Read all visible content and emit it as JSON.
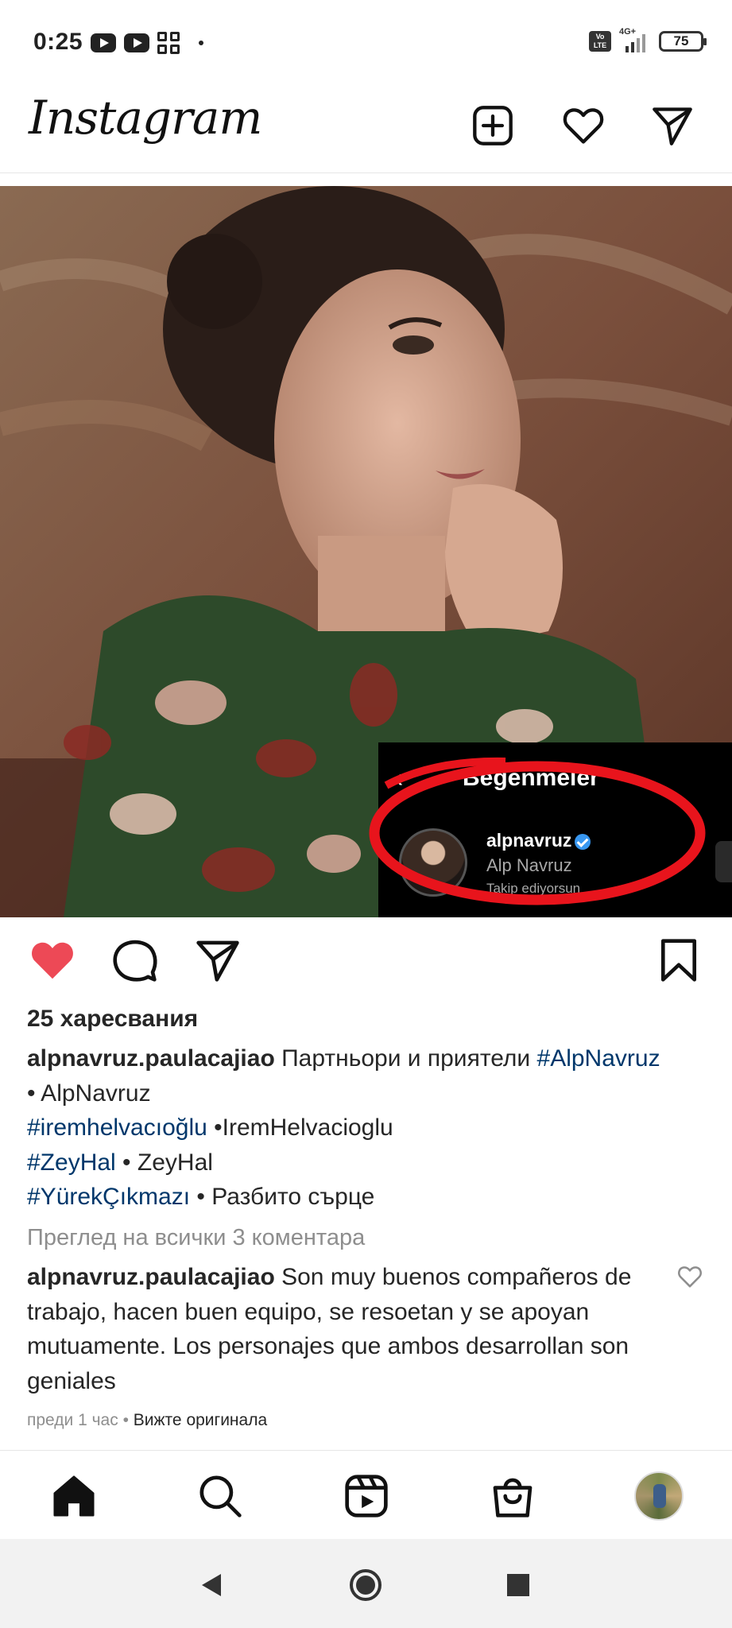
{
  "status_bar": {
    "time": "0:25",
    "network": "4G+",
    "volte": "Vo LTE",
    "battery": "75",
    "icons": [
      "youtube-icon",
      "youtube-icon",
      "app-grid-icon",
      "notification-dot"
    ]
  },
  "header": {
    "logo": "Instagram",
    "icons": [
      "new-post-icon",
      "heart-icon",
      "direct-message-icon"
    ]
  },
  "post": {
    "overlay": {
      "title": "Beğenmeler",
      "username": "alpnavruz",
      "full_name": "Alp Navruz",
      "follow_status": "Takip ediyorsun"
    },
    "liked": true,
    "likes": "25 харесвания",
    "caption": {
      "username": "alpnavruz.paulacajiao",
      "text1": " Партньори и приятели ",
      "tag1": "#AlpNavruz",
      "text2": "• AlpNavruz",
      "tag2": "#iremhelvacıoğlu",
      "text3": " •IremHelvacioglu",
      "tag3": "#ZeyHal",
      "text4": " • ZeyHal",
      "tag4": "#YürekÇıkmazı",
      "text5": " • Разбито сърце"
    },
    "view_comments": "Преглед на всички 3 коментара",
    "comment": {
      "username": "alpnavruz.paulacajiao",
      "text": " Son muy buenos compañeros de trabajo, hacen buen equipo, se resoetan y se apoyan mutuamente. Los personajes que ambos desarrollan son geniales"
    },
    "time_ago": "преди 1 час",
    "separator": " • ",
    "see_original": "Вижте оригинала"
  },
  "bottom_nav": {
    "items": [
      "home-icon",
      "search-icon",
      "reels-icon",
      "shop-icon",
      "profile-avatar"
    ]
  },
  "colors": {
    "like_red": "#ed4956",
    "hashtag_blue": "#00376b",
    "secondary_gray": "#8e8e8e",
    "verified_blue": "#3897f0"
  }
}
